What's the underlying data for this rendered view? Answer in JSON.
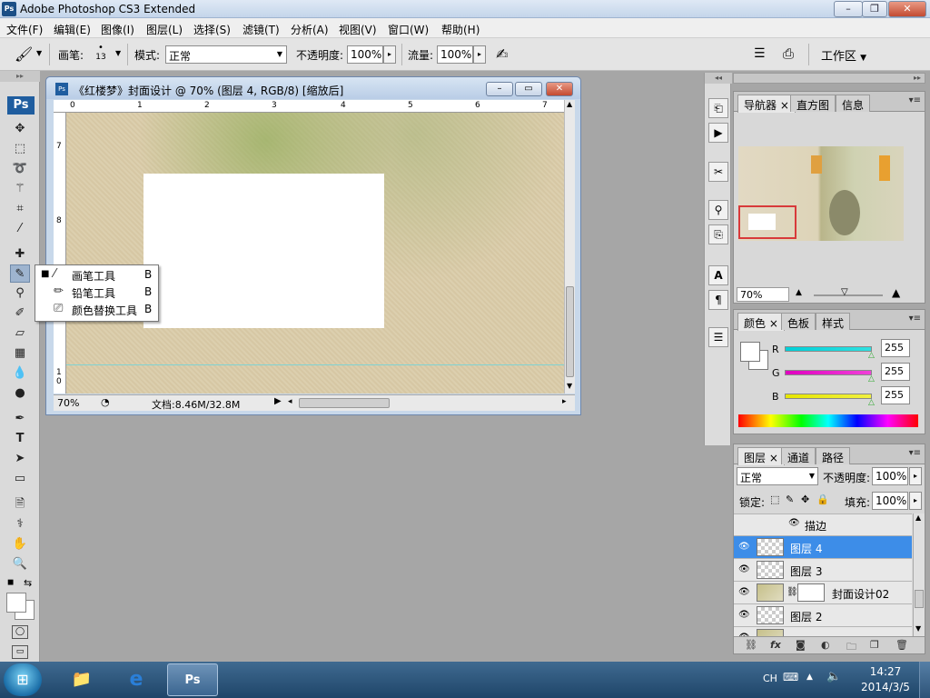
{
  "window": {
    "title": "Adobe Photoshop CS3 Extended",
    "buttons": {
      "minimize": "–",
      "restore": "❐",
      "close": "✕"
    }
  },
  "menu": [
    "文件(F)",
    "编辑(E)",
    "图像(I)",
    "图层(L)",
    "选择(S)",
    "滤镜(T)",
    "分析(A)",
    "视图(V)",
    "窗口(W)",
    "帮助(H)"
  ],
  "options": {
    "brush_label": "画笔:",
    "brush_size": "13",
    "mode_label": "模式:",
    "mode_value": "正常",
    "opacity_label": "不透明度:",
    "opacity_value": "100%",
    "flow_label": "流量:",
    "flow_value": "100%",
    "workspace_label": "工作区"
  },
  "toolbox": {
    "logo": "Ps"
  },
  "flyout": {
    "items": [
      {
        "label": "画笔工具",
        "key": "B",
        "active": true
      },
      {
        "label": "铅笔工具",
        "key": "B",
        "active": false
      },
      {
        "label": "颜色替换工具",
        "key": "B",
        "active": false
      }
    ]
  },
  "document": {
    "title": "《红楼梦》封面设计 @ 70% (图层 4, RGB/8) [缩放后]",
    "zoom": "70%",
    "doc_info": "文档:8.46M/32.8M",
    "ruler_top": [
      "0",
      "1",
      "2",
      "3",
      "4",
      "5",
      "6",
      "7"
    ],
    "ruler_left": [
      "7",
      "8",
      "9",
      "1",
      "0"
    ]
  },
  "navigator_panel": {
    "tabs": [
      "导航器",
      "直方图",
      "信息"
    ],
    "zoom": "70%"
  },
  "color_panel": {
    "tabs": [
      "颜色",
      "色板",
      "样式"
    ],
    "channels": [
      {
        "name": "R",
        "value": "255",
        "color": "#00c8d8"
      },
      {
        "name": "G",
        "value": "255",
        "color": "#e000c0"
      },
      {
        "name": "B",
        "value": "255",
        "color": "#e6e600"
      }
    ]
  },
  "layers_panel": {
    "tabs": [
      "图层",
      "通道",
      "路径"
    ],
    "blend_mode": "正常",
    "opacity_label": "不透明度:",
    "opacity_value": "100%",
    "lock_label": "锁定:",
    "fill_label": "填充:",
    "fill_value": "100%",
    "effect_name": "描边",
    "layers": [
      {
        "name": "图层 4",
        "selected": true
      },
      {
        "name": "图层 3",
        "selected": false
      },
      {
        "name": "封面设计02",
        "selected": false
      },
      {
        "name": "图层 2",
        "selected": false
      }
    ]
  },
  "taskbar": {
    "lang": "CH",
    "time": "14:27",
    "date": "2014/3/5"
  }
}
